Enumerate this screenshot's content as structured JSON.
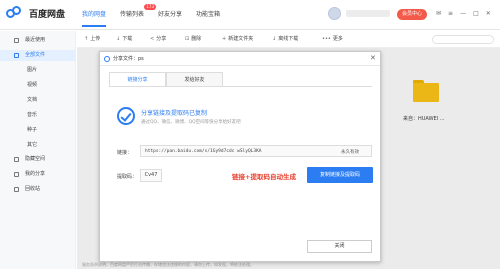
{
  "app": {
    "logo_text": "百度网盘",
    "brand_color": "#2c7df2",
    "accent_red": "#e8412f"
  },
  "top_nav": {
    "tabs": [
      {
        "label": "我的网盘",
        "active": true
      },
      {
        "label": "传输列表",
        "badge": "173"
      },
      {
        "label": "好友分享"
      },
      {
        "label": "功能宝箱"
      }
    ],
    "member_button": "会员中心",
    "window_icons": [
      "✉",
      "≡",
      "—",
      "□",
      "✕"
    ]
  },
  "sidebar": {
    "items": [
      {
        "label": "最近使用"
      },
      {
        "label": "全部文件",
        "active": true
      },
      {
        "label": "图片"
      },
      {
        "label": "视频"
      },
      {
        "label": "文档"
      },
      {
        "label": "音乐"
      },
      {
        "label": "种子"
      },
      {
        "label": "其它"
      },
      {
        "label": "隐藏空间"
      },
      {
        "label": "我的分享"
      },
      {
        "label": "回收站"
      }
    ]
  },
  "toolbar": {
    "buttons": [
      {
        "icon": "↑",
        "label": "上传"
      },
      {
        "icon": "↓",
        "label": "下载"
      },
      {
        "icon": "<",
        "label": "分享"
      },
      {
        "icon": "⊡",
        "label": "删除"
      },
      {
        "icon": "+",
        "label": "新建文件夹"
      },
      {
        "icon": "↓",
        "label": "离线下载"
      },
      {
        "icon": "•••",
        "label": "更多"
      }
    ]
  },
  "file_area": {
    "folder_label": "来自：HUAWEI ...",
    "bottom_text": "服务条例说明，百度网盘严厉打击传播，存储违法违规的内容，请勿上传，如发现，将依法处理。"
  },
  "dialog": {
    "title": "分享文件：ps",
    "close_icon": "✕",
    "tabs": [
      {
        "label": "链接分享",
        "active": true
      },
      {
        "label": "发给好友"
      }
    ],
    "success_title": "分享链接及提取码已复制",
    "success_subtitle": "通过QQ、微信、微博、QQ空间等快分享给好友吧",
    "link_label": "链接：",
    "link_value": "https://pan.baidu.com/s/1Gy9d7cdc  wSlyQL3KA",
    "link_expire": "永久有效",
    "code_label": "提取码：",
    "code_value": "Cv47",
    "annotation": "链接+提取码自动生成",
    "copy_button": "复制链接及提取码",
    "close_button": "关闭"
  }
}
